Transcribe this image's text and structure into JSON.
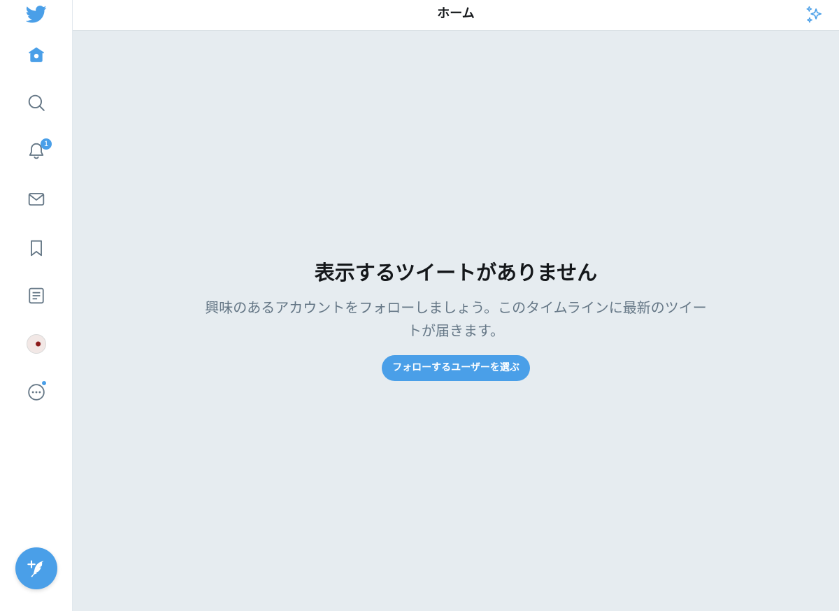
{
  "header": {
    "title": "ホーム"
  },
  "sidebar": {
    "items": [
      {
        "name": "home",
        "icon": "home-icon"
      },
      {
        "name": "explore",
        "icon": "search-icon"
      },
      {
        "name": "notifications",
        "icon": "bell-icon",
        "badge": "1"
      },
      {
        "name": "messages",
        "icon": "mail-icon"
      },
      {
        "name": "bookmarks",
        "icon": "bookmark-icon"
      },
      {
        "name": "lists",
        "icon": "list-icon"
      },
      {
        "name": "profile",
        "icon": "avatar"
      },
      {
        "name": "more",
        "icon": "more-icon",
        "has_dot": true
      }
    ],
    "compose_icon": "compose-tweet-icon"
  },
  "empty_state": {
    "title": "表示するツイートがありません",
    "description": "興味のあるアカウントをフォローしましょう。このタイムラインに最新のツイートが届きます。",
    "button_label": "フォローするユーザーを選ぶ"
  },
  "colors": {
    "accent": "#4a9fe8",
    "background": "#e6ecf0",
    "secondary_text": "#657786",
    "icon_gray": "#657786"
  }
}
